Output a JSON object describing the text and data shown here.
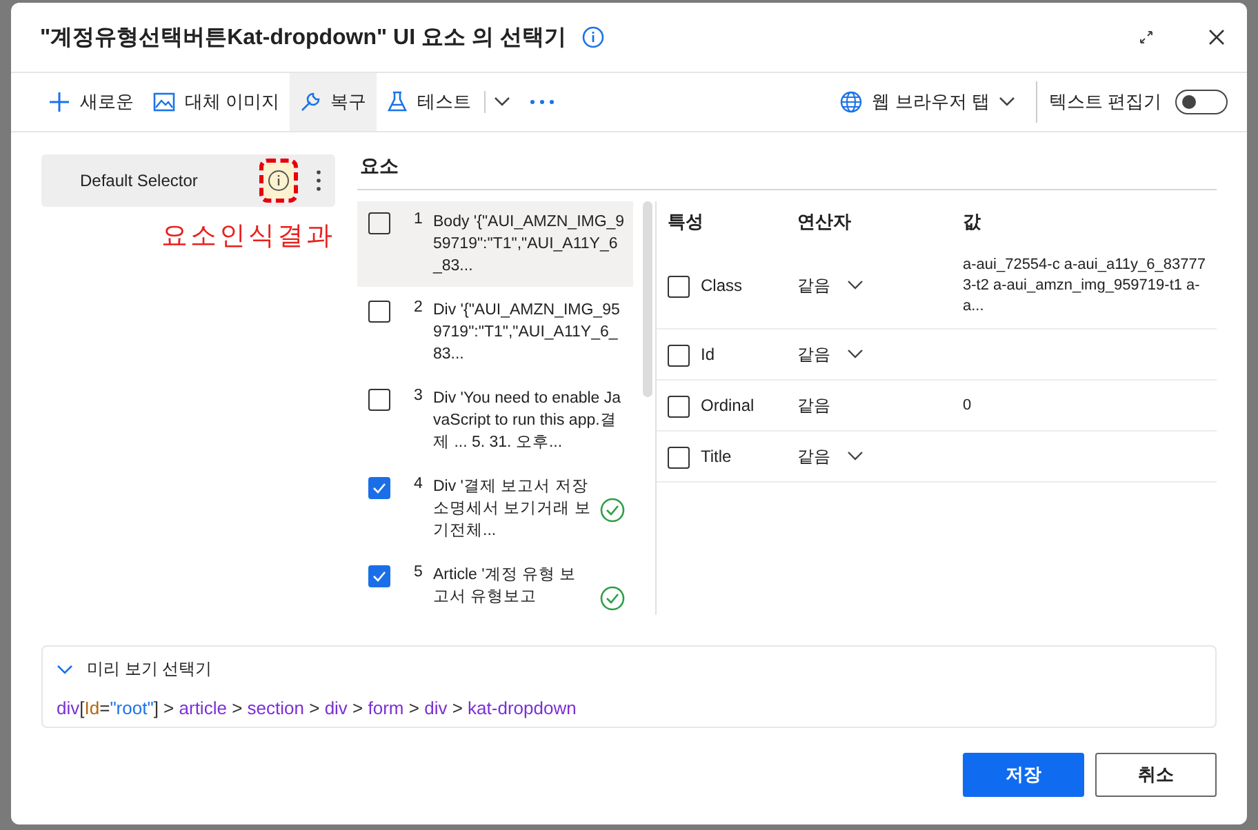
{
  "window": {
    "title": "\"계정유형선택버튼Kat-dropdown\" UI 요소 의 선택기"
  },
  "toolbar": {
    "items": [
      {
        "kind": "plus",
        "label": "새로운",
        "selected": false
      },
      {
        "kind": "image",
        "label": "대체 이미지",
        "selected": false
      },
      {
        "kind": "wrench",
        "label": "복구",
        "selected": true
      },
      {
        "kind": "flask",
        "label": "테스트",
        "selected": false
      }
    ],
    "browser_tab": {
      "label": "웹 브라우저 탭"
    },
    "text_editor": {
      "label": "텍스트 편집기",
      "on": false
    }
  },
  "selectors": [
    {
      "label": "Default Selector",
      "selected": true
    }
  ],
  "annotation": "요소인식결과",
  "elements": {
    "title": "요소",
    "items": [
      {
        "number": "1",
        "text": "Body '{\"AUI_AMZN_IMG_959719\":\"T1\",\"AUI_A11Y_6_83...",
        "checked": false,
        "selected": true,
        "matched": false
      },
      {
        "number": "2",
        "text": "Div '{\"AUI_AMZN_IMG_959719\":\"T1\",\"AUI_A11Y_6_83...",
        "checked": false,
        "selected": false,
        "matched": false
      },
      {
        "number": "3",
        "text": "Div 'You need to enable JavaScript to run this app.결제  ...  5. 31. 오후...",
        "checked": false,
        "selected": false,
        "matched": false
      },
      {
        "number": "4",
        "text": "Div '결제 보고서 저장소명세서 보기거래 보기전체...",
        "checked": true,
        "selected": false,
        "matched": true
      },
      {
        "number": "5",
        "text": "Article '계정 유형 보고서 유형보고",
        "checked": true,
        "selected": false,
        "matched": true
      }
    ]
  },
  "properties": {
    "columns": [
      "특성",
      "연산자",
      "값"
    ],
    "rows": [
      {
        "name": "Class",
        "operator": "같음",
        "dropdown": true,
        "value": "a-aui_72554-c a-aui_a11y_6_837773-t2 a-aui_amzn_img_959719-t1 a-a...",
        "checked": false
      },
      {
        "name": "Id",
        "operator": "같음",
        "dropdown": true,
        "value": "",
        "checked": false
      },
      {
        "name": "Ordinal",
        "operator": "같음",
        "dropdown": false,
        "value": "0",
        "checked": false
      },
      {
        "name": "Title",
        "operator": "같음",
        "dropdown": true,
        "value": "",
        "checked": false
      }
    ]
  },
  "preview": {
    "title": "미리 보기 선택기",
    "expanded": true,
    "tokens": [
      {
        "kind": "tag",
        "text": "div"
      },
      {
        "kind": "punct",
        "text": "["
      },
      {
        "kind": "attr",
        "text": "Id"
      },
      {
        "kind": "punct",
        "text": "="
      },
      {
        "kind": "string",
        "text": "\"root\""
      },
      {
        "kind": "punct",
        "text": "] > "
      },
      {
        "kind": "tag",
        "text": "article"
      },
      {
        "kind": "punct",
        "text": " > "
      },
      {
        "kind": "tag",
        "text": "section"
      },
      {
        "kind": "punct",
        "text": " > "
      },
      {
        "kind": "tag",
        "text": "div"
      },
      {
        "kind": "punct",
        "text": " > "
      },
      {
        "kind": "tag",
        "text": "form"
      },
      {
        "kind": "punct",
        "text": " > "
      },
      {
        "kind": "tag",
        "text": "div"
      },
      {
        "kind": "punct",
        "text": " > "
      },
      {
        "kind": "tag",
        "text": "kat-dropdown"
      }
    ]
  },
  "buttons": [
    {
      "label": "저장",
      "kind": "primary"
    },
    {
      "label": "취소",
      "kind": "secondary"
    }
  ]
}
